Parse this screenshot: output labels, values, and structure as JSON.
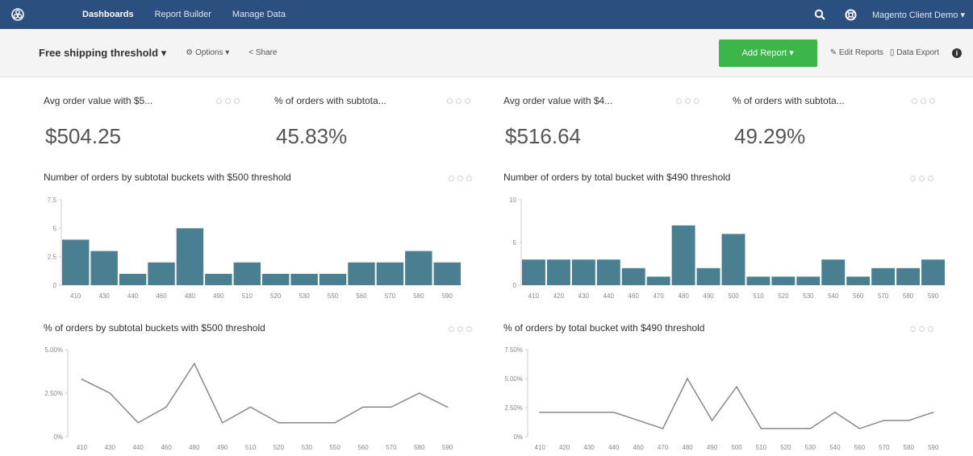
{
  "nav": {
    "links": [
      "Dashboards",
      "Report Builder",
      "Manage Data"
    ],
    "account": "Magento Client Demo"
  },
  "toolbar": {
    "title": "Free shipping threshold",
    "options": "Options",
    "share": "Share",
    "add_report": "Add Report",
    "edit_reports": "Edit Reports",
    "data_export": "Data Export"
  },
  "kpis": [
    {
      "title": "Avg order value with $5...",
      "value": "$504.25"
    },
    {
      "title": "% of orders with subtota...",
      "value": "45.83%"
    },
    {
      "title": "Avg order value with $4...",
      "value": "$516.64"
    },
    {
      "title": "% of orders with subtota...",
      "value": "49.29%"
    }
  ],
  "charts": {
    "bar1_title": "Number of orders by subtotal buckets with $500 threshold",
    "bar2_title": "Number of orders by total bucket with $490 threshold",
    "line1_title": "% of orders by subtotal buckets with $500 threshold",
    "line2_title": "% of orders by total bucket with $490 threshold"
  },
  "chart_data": [
    {
      "type": "bar",
      "title": "Number of orders by subtotal buckets with $500 threshold",
      "categories": [
        "410",
        "430",
        "440",
        "460",
        "480",
        "490",
        "510",
        "520",
        "530",
        "550",
        "560",
        "570",
        "580",
        "590"
      ],
      "values": [
        4,
        3,
        1,
        2,
        5,
        1,
        2,
        1,
        1,
        1,
        2,
        2,
        3,
        2
      ],
      "ylim": [
        0,
        7.5
      ],
      "yticks": [
        "0",
        "2.5",
        "5",
        "7.5"
      ],
      "color": "#4a7f92"
    },
    {
      "type": "bar",
      "title": "Number of orders by total bucket with $490 threshold",
      "categories": [
        "410",
        "420",
        "430",
        "440",
        "460",
        "470",
        "480",
        "490",
        "500",
        "510",
        "520",
        "530",
        "540",
        "560",
        "570",
        "580",
        "590"
      ],
      "values": [
        3,
        3,
        3,
        3,
        2,
        1,
        7,
        2,
        6,
        1,
        1,
        1,
        3,
        1,
        2,
        2,
        3
      ],
      "ylim": [
        0,
        10
      ],
      "yticks": [
        "0",
        "5",
        "10"
      ],
      "color": "#4a7f92"
    },
    {
      "type": "line",
      "title": "% of orders by subtotal buckets with $500 threshold",
      "categories": [
        "410",
        "430",
        "440",
        "460",
        "480",
        "490",
        "510",
        "520",
        "530",
        "550",
        "560",
        "570",
        "580",
        "590"
      ],
      "values": [
        3.3,
        2.5,
        0.8,
        1.7,
        4.2,
        0.8,
        1.7,
        0.8,
        0.8,
        0.8,
        1.7,
        1.7,
        2.5,
        1.7
      ],
      "ylim": [
        0,
        5
      ],
      "yticks": [
        "0%",
        "2.50%",
        "5.00%"
      ],
      "color": "#888888"
    },
    {
      "type": "line",
      "title": "% of orders by total bucket with $490 threshold",
      "categories": [
        "410",
        "420",
        "430",
        "440",
        "460",
        "470",
        "480",
        "490",
        "500",
        "510",
        "520",
        "530",
        "540",
        "560",
        "570",
        "580",
        "590"
      ],
      "values": [
        2.1,
        2.1,
        2.1,
        2.1,
        1.4,
        0.7,
        5.0,
        1.4,
        4.3,
        0.7,
        0.7,
        0.7,
        2.1,
        0.7,
        1.4,
        1.4,
        2.1
      ],
      "ylim": [
        0,
        7.5
      ],
      "yticks": [
        "0%",
        "2.50%",
        "5.00%",
        "7.50%"
      ],
      "color": "#888888"
    }
  ]
}
